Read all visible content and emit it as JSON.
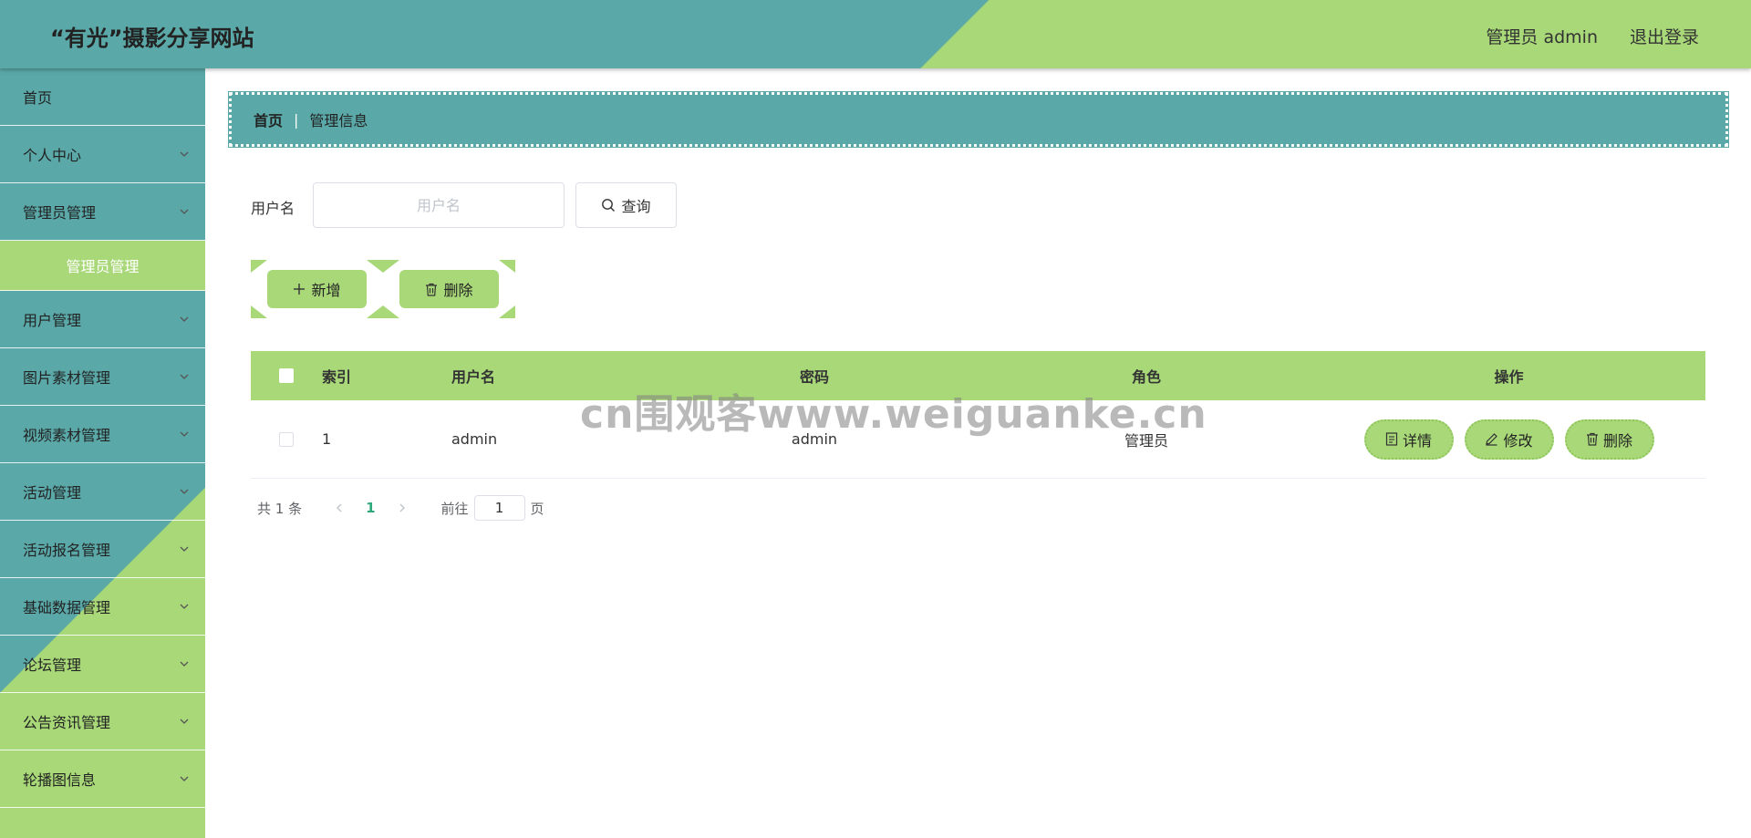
{
  "header": {
    "site_title": "“有光”摄影分享网站",
    "user_label": "管理员 admin",
    "logout_label": "退出登录"
  },
  "sidebar": {
    "items": [
      {
        "label": "首页",
        "has_chevron": false
      },
      {
        "label": "个人中心",
        "has_chevron": true
      },
      {
        "label": "管理员管理",
        "has_chevron": true
      },
      {
        "label": "用户管理",
        "has_chevron": true
      },
      {
        "label": "图片素材管理",
        "has_chevron": true
      },
      {
        "label": "视频素材管理",
        "has_chevron": true
      },
      {
        "label": "活动管理",
        "has_chevron": true
      },
      {
        "label": "活动报名管理",
        "has_chevron": true
      },
      {
        "label": "基础数据管理",
        "has_chevron": true
      },
      {
        "label": "论坛管理",
        "has_chevron": true
      },
      {
        "label": "公告资讯管理",
        "has_chevron": true
      },
      {
        "label": "轮播图信息",
        "has_chevron": true
      }
    ],
    "active_sub": "管理员管理"
  },
  "breadcrumb": {
    "home": "首页",
    "separator": "|",
    "current": "管理信息"
  },
  "search": {
    "label": "用户名",
    "placeholder": "用户名",
    "value": "",
    "button_label": "查询"
  },
  "actions": {
    "add_label": "新增",
    "delete_label": "删除"
  },
  "table": {
    "columns": [
      "索引",
      "用户名",
      "密码",
      "角色",
      "操作"
    ],
    "rows": [
      {
        "index": "1",
        "username": "admin",
        "password": "admin",
        "role": "管理员"
      }
    ],
    "row_actions": {
      "detail": "详情",
      "edit": "修改",
      "delete": "删除"
    }
  },
  "pagination": {
    "total": "共 1 条",
    "current_page": "1",
    "goto_label": "前往",
    "goto_value": "1",
    "page_suffix": "页"
  },
  "watermark": "cn围观客www.weiguanke.cn",
  "colors": {
    "teal": "#5aa8a8",
    "green": "#a8d878",
    "page_active": "#2fa87a"
  }
}
